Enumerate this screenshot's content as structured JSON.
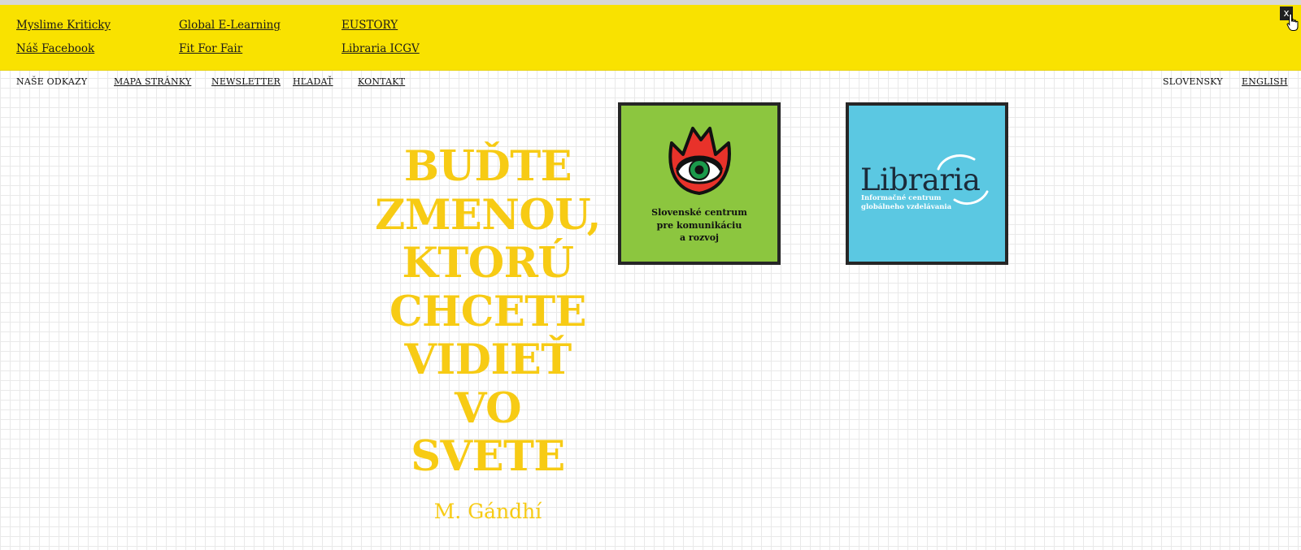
{
  "top_links": [
    {
      "label": "Myslime Kriticky"
    },
    {
      "label": "Náš Facebook"
    },
    {
      "label": "Global E-Learning"
    },
    {
      "label": "Fit For Fair"
    },
    {
      "label": "EUSTORY"
    },
    {
      "label": "Libraria ICGV"
    }
  ],
  "close_label": "x",
  "nav": {
    "our_links": "NAŠE ODKAZY",
    "items": [
      {
        "label": "MAPA STRÁNKY"
      },
      {
        "label": "NEWSLETTER"
      },
      {
        "label": "HĽADAŤ"
      },
      {
        "label": "KONTAKT"
      }
    ]
  },
  "languages": {
    "current": "SLOVENSKY",
    "other": "ENGLISH"
  },
  "quote": {
    "lines": [
      "BUĎTE",
      "ZMENOU,",
      "KTORÚ",
      "CHCETE",
      "VIDIEŤ",
      "VO",
      "SVETE"
    ],
    "author": "M. Gándhí"
  },
  "logos": {
    "sccd": {
      "lines": [
        "Slovenské centrum",
        "pre komunikáciu",
        "a rozvoj"
      ]
    },
    "libraria": {
      "name": "Libraria",
      "sub_lines": [
        "Informačné centrum",
        "globálneho vzdelávania"
      ]
    }
  },
  "colors": {
    "yellow_bar": "#f9e200",
    "quote_yellow": "#f7cb14",
    "sccd_green": "#8cc63f",
    "libraria_blue": "#5bc8e2"
  },
  "icons": {
    "close": "close-icon",
    "cursor": "hand-cursor-icon",
    "sccd": "tulip-eye-icon"
  }
}
